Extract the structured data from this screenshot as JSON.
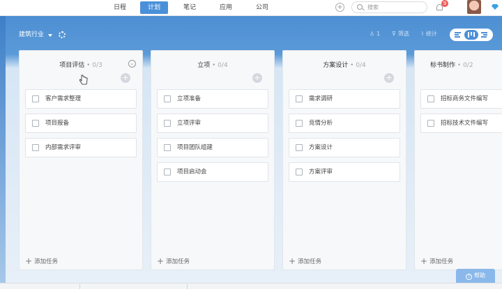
{
  "nav": {
    "items": [
      {
        "label": "日程",
        "active": false
      },
      {
        "label": "计划",
        "active": true
      },
      {
        "label": "笔记",
        "active": false
      },
      {
        "label": "应用",
        "active": false
      },
      {
        "label": "公司",
        "active": false
      }
    ]
  },
  "topbar": {
    "add_icon": "plus-circle-icon",
    "search_placeholder": "搜索",
    "notification_count": "9"
  },
  "project": {
    "name": "建筑行业",
    "settings_icon": "gear-icon"
  },
  "toolbar": {
    "members_count": "1",
    "filter_label": "筛选",
    "stats_label": "统计",
    "view_options": [
      "list-view",
      "board-view",
      "gantt-view"
    ],
    "selected_view": "board-view"
  },
  "columns": [
    {
      "title": "项目评估",
      "count": "0/3",
      "tasks": [
        "客户需求整理",
        "项目报备",
        "内部需求评审"
      ],
      "add_label": "添加任务"
    },
    {
      "title": "立项",
      "count": "0/4",
      "tasks": [
        "立项准备",
        "立项评审",
        "项目团队组建",
        "项目启动会"
      ],
      "add_label": "添加任务"
    },
    {
      "title": "方案设计",
      "count": "0/4",
      "tasks": [
        "需求调研",
        "竞情分析",
        "方案设计",
        "方案评审"
      ],
      "add_label": "添加任务"
    },
    {
      "title": "标书制作",
      "count": "0/2",
      "tasks": [
        "招标商务文件编写",
        "招标技术文件编写"
      ],
      "add_label": "添加任务"
    }
  ],
  "help": {
    "label": "帮助"
  },
  "colors": {
    "accent": "#4a90d9",
    "header": "#4d8fd3",
    "badge": "#f05a5a"
  }
}
